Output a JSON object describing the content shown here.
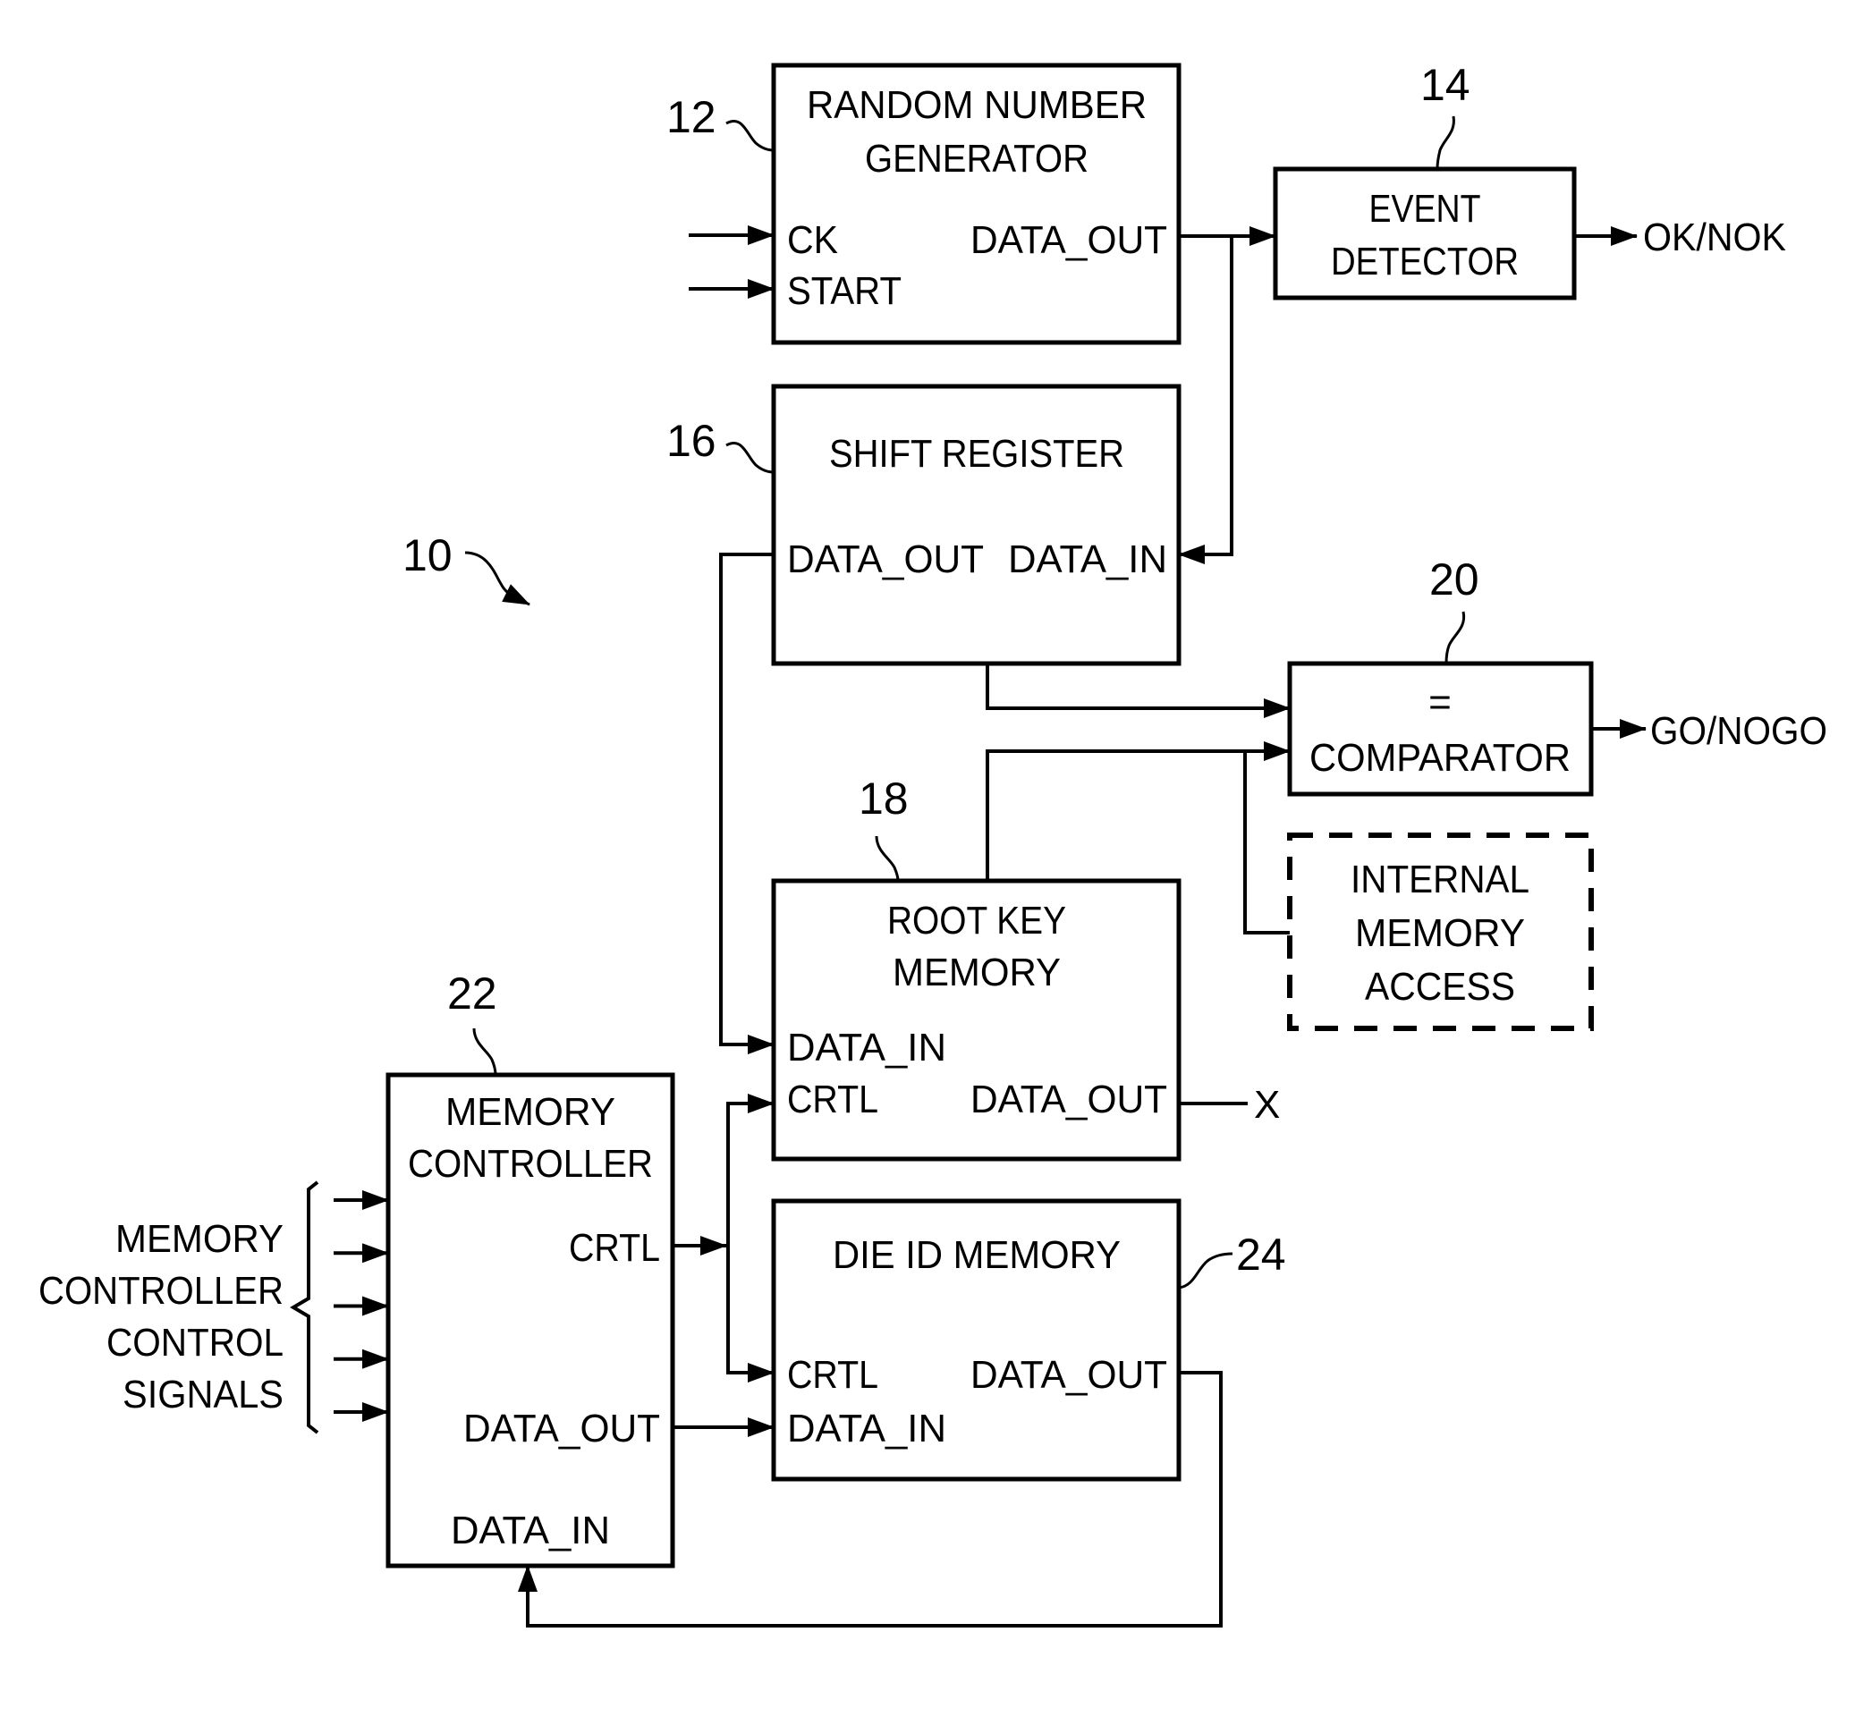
{
  "figure": {
    "overall_ref": "10",
    "blocks": {
      "rng": {
        "ref": "12",
        "title": [
          "RANDOM NUMBER",
          "GENERATOR"
        ],
        "ports": {
          "ck": "CK",
          "start": "START",
          "data_out": "DATA_OUT"
        }
      },
      "event_detector": {
        "ref": "14",
        "title": [
          "EVENT",
          "DETECTOR"
        ],
        "output": "OK/NOK"
      },
      "shift_register": {
        "ref": "16",
        "title": [
          "SHIFT REGISTER"
        ],
        "ports": {
          "data_out": "DATA_OUT",
          "data_in": "DATA_IN"
        }
      },
      "root_key_memory": {
        "ref": "18",
        "title": [
          "ROOT KEY",
          "MEMORY"
        ],
        "ports": {
          "data_in": "DATA_IN",
          "crtl": "CRTL",
          "data_out": "DATA_OUT"
        },
        "output": "X"
      },
      "comparator": {
        "ref": "20",
        "symbol": "=",
        "title": [
          "COMPARATOR"
        ],
        "output": "GO/NOGO"
      },
      "internal_memory_access": {
        "title": [
          "INTERNAL",
          "MEMORY",
          "ACCESS"
        ],
        "style": "dashed"
      },
      "memory_controller": {
        "ref": "22",
        "title": [
          "MEMORY",
          "CONTROLLER"
        ],
        "ports": {
          "crtl": "CRTL",
          "data_out": "DATA_OUT",
          "data_in": "DATA_IN"
        }
      },
      "die_id_memory": {
        "ref": "24",
        "title": [
          "DIE ID MEMORY"
        ],
        "ports": {
          "crtl": "CRTL",
          "data_in": "DATA_IN",
          "data_out": "DATA_OUT"
        }
      }
    },
    "control_signals_label": [
      "MEMORY",
      "CONTROLLER",
      "CONTROL",
      "SIGNALS"
    ],
    "control_signal_count": 5
  }
}
